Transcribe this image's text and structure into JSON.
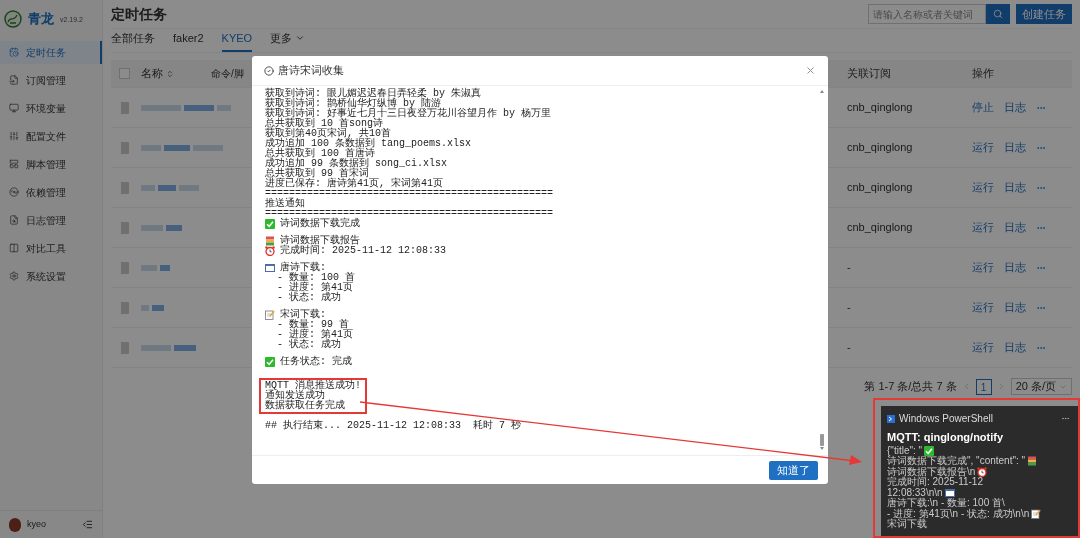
{
  "sidebar": {
    "title": "青龙",
    "version": "v2.19.2",
    "items": [
      {
        "label": "定时任务",
        "selected": true
      },
      {
        "label": "订阅管理",
        "selected": false
      },
      {
        "label": "环境变量",
        "selected": false
      },
      {
        "label": "配置文件",
        "selected": false
      },
      {
        "label": "脚本管理",
        "selected": false
      },
      {
        "label": "依赖管理",
        "selected": false
      },
      {
        "label": "日志管理",
        "selected": false
      },
      {
        "label": "对比工具",
        "selected": false
      },
      {
        "label": "系统设置",
        "selected": false
      }
    ],
    "user": "kyeo"
  },
  "page": {
    "title": "定时任务",
    "search": {
      "placeholder": "请输入名称或者关键词"
    },
    "create_button": "创建任务"
  },
  "tabs": [
    {
      "label": "全部任务",
      "selected": false,
      "kind": "tab"
    },
    {
      "label": "faker2",
      "selected": false,
      "kind": "tab"
    },
    {
      "label": "KYEO",
      "selected": true,
      "kind": "tab"
    },
    {
      "label": "更多",
      "selected": false,
      "kind": "menu"
    }
  ],
  "table": {
    "select_all": {
      "checked": false
    },
    "columns": [
      "名称",
      "命令/脚",
      "关联订阅",
      "操作"
    ],
    "rows": [
      {
        "subscription": "cnb_qinglong",
        "actions": [
          "停止",
          "日志"
        ]
      },
      {
        "subscription": "cnb_qinglong",
        "actions": [
          "运行",
          "日志"
        ]
      },
      {
        "subscription": "cnb_qinglong",
        "actions": [
          "运行",
          "日志"
        ]
      },
      {
        "subscription": "cnb_qinglong",
        "actions": [
          "运行",
          "日志"
        ]
      },
      {
        "subscription": "-",
        "actions": [
          "运行",
          "日志"
        ]
      },
      {
        "subscription": "-",
        "actions": [
          "运行",
          "日志"
        ]
      },
      {
        "subscription": "-",
        "actions": [
          "运行",
          "日志"
        ]
      }
    ]
  },
  "pagination": {
    "summary": "第 1-7 条/总共 7 条",
    "pages": [
      {
        "label": "1",
        "selected": true
      }
    ],
    "page_size": "20 条/页"
  },
  "dialog": {
    "title": "唐诗宋词收集",
    "button": "知道了",
    "blocks": [
      {
        "highlighted": false,
        "lines": [
          {
            "kind": "text",
            "text": "获取到诗词: 眼儿媚迟迟春日弄轻柔 by 朱淑真"
          },
          {
            "kind": "text",
            "text": "获取到诗词: 鹊桥仙华灯纵博 by 陆游"
          },
          {
            "kind": "text",
            "text": "获取到诗词: 好事近七月十三日夜登万花川谷望月作 by 杨万里"
          },
          {
            "kind": "text",
            "text": "总共获取到 10 首song诗"
          },
          {
            "kind": "text",
            "text": "获取到第40页宋词, 共10首"
          },
          {
            "kind": "text",
            "text": "成功追加 100 条数据到 tang_poems.xlsx"
          },
          {
            "kind": "text",
            "text": "总共获取到 100 首唐诗"
          },
          {
            "kind": "text",
            "text": "成功追加 99 条数据到 song_ci.xlsx"
          },
          {
            "kind": "text",
            "text": "总共获取到 99 首宋词"
          },
          {
            "kind": "text",
            "text": "进度已保存: 唐诗第41页, 宋词第41页"
          },
          {
            "kind": "text",
            "text": "================================================"
          },
          {
            "kind": "text",
            "text": "推送通知"
          },
          {
            "kind": "text",
            "text": "================================================"
          },
          {
            "kind": "done",
            "text": "诗词数据下载完成"
          }
        ]
      },
      {
        "highlighted": false,
        "lines": [
          {
            "kind": "report",
            "text": "诗词数据下载报告"
          },
          {
            "kind": "time",
            "text": "完成时间: 2025-11-12 12:08:33"
          }
        ]
      },
      {
        "highlighted": false,
        "lines": [
          {
            "kind": "section",
            "text": "唐诗下载:"
          },
          {
            "kind": "text",
            "text": "  - 数量: 100 首"
          },
          {
            "kind": "text",
            "text": "  - 进度: 第41页"
          },
          {
            "kind": "text",
            "text": "  - 状态: 成功"
          }
        ]
      },
      {
        "highlighted": false,
        "lines": [
          {
            "kind": "note",
            "text": "宋词下载:"
          },
          {
            "kind": "text",
            "text": "  - 数量: 99 首"
          },
          {
            "kind": "text",
            "text": "  - 进度: 第41页"
          },
          {
            "kind": "text",
            "text": "  - 状态: 成功"
          }
        ]
      },
      {
        "highlighted": false,
        "lines": [
          {
            "kind": "done",
            "text": "任务状态: 完成"
          }
        ]
      },
      {
        "highlighted": true,
        "lines": [
          {
            "kind": "text",
            "text": "MQTT 消息推送成功!"
          },
          {
            "kind": "text",
            "text": "通知发送成功"
          },
          {
            "kind": "text",
            "text": "数据获取任务完成"
          }
        ]
      },
      {
        "highlighted": false,
        "lines": [
          {
            "kind": "text",
            "text": "## 执行结束... 2025-11-12 12:08:33  耗时 7 秒"
          }
        ]
      }
    ]
  },
  "notification": {
    "app": "Windows PowerShell",
    "title": "MQTT: qinglong/notify",
    "lines": [
      [
        {
          "kind": "text",
          "text": "{\"title\": \""
        },
        {
          "kind": "done"
        },
        {
          "kind": "text",
          "text": " 诗词数据下载完成\", \"content\": \""
        },
        {
          "kind": "report"
        }
      ],
      [
        {
          "kind": "text",
          "text": "诗词数据下载报告\\n"
        },
        {
          "kind": "time"
        },
        {
          "kind": "text",
          "text": " 完成时间: 2025-11-12"
        }
      ],
      [
        {
          "kind": "text",
          "text": "12:08:33\\n\\n"
        },
        {
          "kind": "section"
        },
        {
          "kind": "text",
          "text": " 唐诗下载:\\n   - 数量: 100 首\\"
        }
      ],
      [
        {
          "kind": "text",
          "text": "- 进度: 第41页\\n   - 状态: 成功\\n\\n"
        },
        {
          "kind": "note"
        },
        {
          "kind": "text",
          "text": " 宋词下载"
        }
      ]
    ]
  }
}
